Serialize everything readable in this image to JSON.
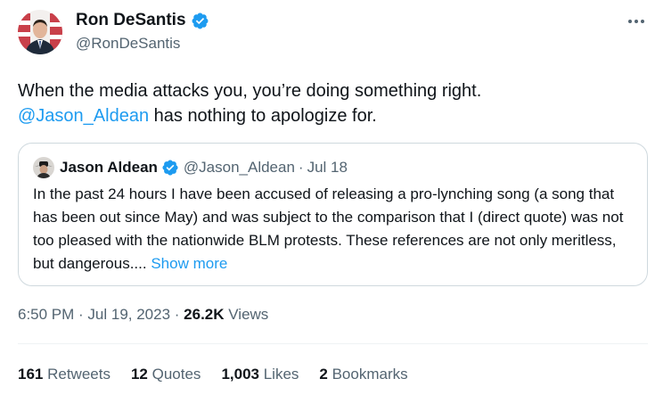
{
  "author": {
    "display_name": "Ron DeSantis",
    "handle": "@RonDeSantis"
  },
  "tweet": {
    "text_line1": "When the media attacks you, you’re doing something right.",
    "mention": "@Jason_Aldean",
    "text_line2_rest": " has nothing to apologize for."
  },
  "quoted": {
    "display_name": "Jason Aldean",
    "handle": "@Jason_Aldean",
    "separator": "·",
    "date": "Jul 18",
    "text": "In the past 24 hours I have been accused of releasing a pro-lynching song (a song that has been out since May) and was subject to the comparison that I (direct quote) was not too pleased with the nationwide BLM protests. These references are not only meritless, but dangerous.... ",
    "show_more": "Show more"
  },
  "meta": {
    "time": "6:50 PM",
    "separator": " · ",
    "date": "Jul 19, 2023",
    "views_count": "26.2K",
    "views_label": " Views"
  },
  "stats": {
    "retweets_count": "161",
    "retweets_label": " Retweets",
    "quotes_count": "12",
    "quotes_label": " Quotes",
    "likes_count": "1,003",
    "likes_label": " Likes",
    "bookmarks_count": "2",
    "bookmarks_label": " Bookmarks"
  },
  "colors": {
    "link": "#1d9bf0",
    "verified": "#1d9bf0",
    "secondary_text": "#536471",
    "border": "#cfd9de"
  },
  "icons": {
    "verified": "verified-badge-icon",
    "more": "more-options-icon"
  }
}
